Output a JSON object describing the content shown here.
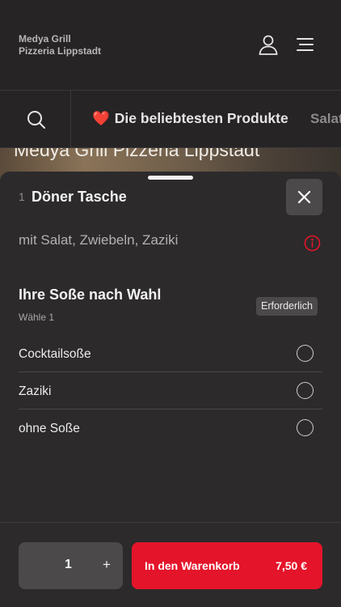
{
  "header": {
    "brand_line1": "Medya Grill",
    "brand_line2": "Pizzeria Lippstadt",
    "icons": [
      "user-icon",
      "menu-icon"
    ]
  },
  "categories": {
    "active_icon": "heart-icon",
    "active_heart": "❤️",
    "active_label": "Die beliebtesten Produkte",
    "next_label": "Salat"
  },
  "hero": {
    "title": "Medya Grill Pizzeria Lippstadt"
  },
  "sheet": {
    "qty_tag": "1",
    "product_title": "Döner Tasche",
    "description": "mit Salat, Zwiebeln, Zaziki",
    "group": {
      "title": "Ihre Soße nach Wahl",
      "subtitle": "Wähle 1",
      "badge": "Erforderlich",
      "options": [
        {
          "label": "Cocktailsoße",
          "selected": false
        },
        {
          "label": "Zaziki",
          "selected": false
        },
        {
          "label": "ohne Soße",
          "selected": false
        }
      ]
    }
  },
  "footer": {
    "quantity": "1",
    "plus": "+",
    "cart_label": "In den Warenkorb",
    "cart_price": "7,50 €"
  },
  "colors": {
    "accent": "#e4142a",
    "background": "#232122",
    "sheet": "#2c2a2b"
  }
}
